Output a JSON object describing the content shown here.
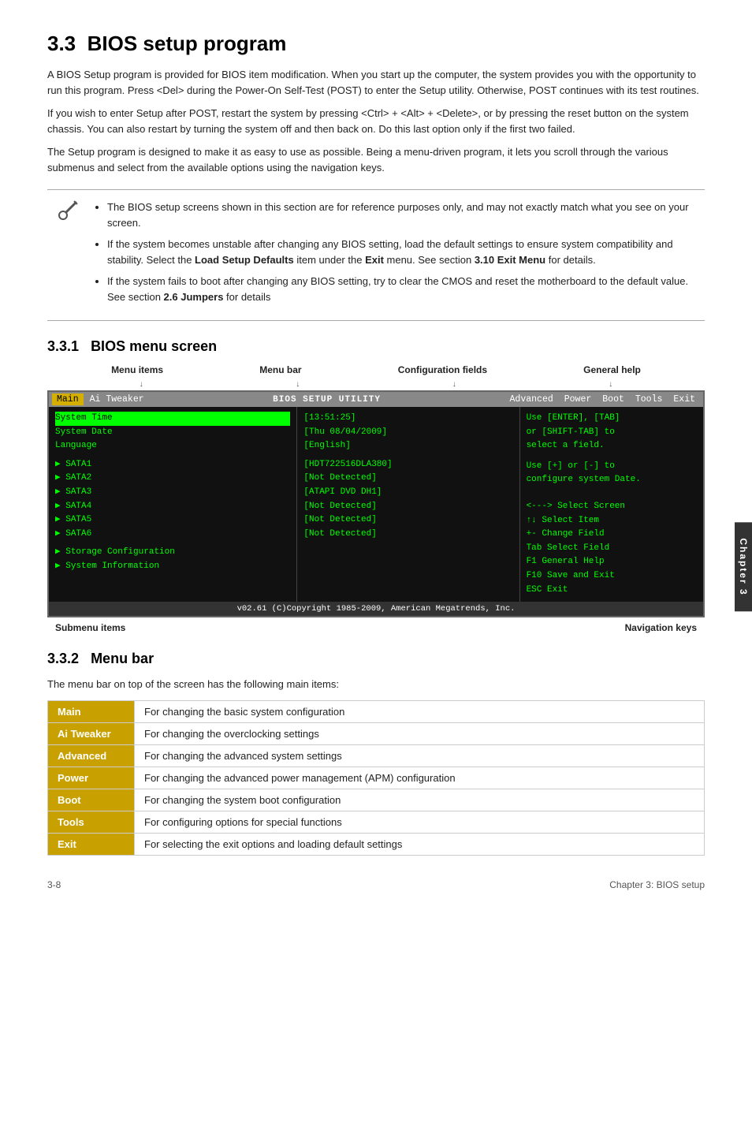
{
  "page": {
    "section": "3.3",
    "title": "BIOS setup program",
    "intro_paragraphs": [
      "A BIOS Setup program is provided for BIOS item modification. When you start up the computer, the system provides you with the opportunity to run this program. Press <Del> during the Power-On Self-Test (POST) to enter the Setup utility. Otherwise, POST continues with its test routines.",
      "If you wish to enter Setup after POST, restart the system by pressing <Ctrl> + <Alt> + <Delete>, or by pressing the reset button on the system chassis. You can also restart by turning the system off and then back on. Do this last option only if the first two failed.",
      "The Setup program is designed to make it as easy to use as possible. Being a menu-driven program, it lets you scroll through the various submenus and select from the available options using the navigation keys."
    ],
    "notes": [
      "The BIOS setup screens shown in this section are for reference purposes only, and may not exactly match what you see on your screen.",
      "If the system becomes unstable after changing any BIOS setting, load the default settings to ensure system compatibility and stability. Select the Load Setup Defaults item under the Exit menu. See section 3.10 Exit Menu for details.",
      "If the system fails to boot after changing any BIOS setting, try to clear the CMOS and reset the motherboard to the default value. See section 2.6 Jumpers for details"
    ],
    "subsection_331": {
      "number": "3.3.1",
      "title": "BIOS menu screen"
    },
    "bios_screen": {
      "title": "BIOS SETUP UTILITY",
      "menu_items": [
        "Main",
        "Ai Tweaker",
        "Advanced",
        "Power",
        "Boot",
        "Tools",
        "Exit"
      ],
      "active_menu": "Main",
      "left_panel": {
        "items": [
          "System Time",
          "System Date",
          "Language",
          "",
          "SATA1",
          "SATA2",
          "SATA3",
          "SATA4",
          "SATA5",
          "SATA6",
          "",
          "Storage Configuration",
          "System Information"
        ]
      },
      "middle_panel": {
        "items": [
          "[13:51:25]",
          "[Thu 08/04/2009]",
          "[English]",
          "",
          "[HDT722516DLA380]",
          "[Not Detected]",
          "[ATAPI DVD DH1]",
          "[Not Detected]",
          "[Not Detected]",
          "[Not Detected]"
        ]
      },
      "right_panel": {
        "help_text": [
          "Use [ENTER], [TAB]",
          "or [SHIFT-TAB] to",
          "select a field.",
          "",
          "Use [+] or [-] to",
          "configure system Date."
        ],
        "nav_text": [
          "<--->  Select Screen",
          "↑↓     Select Item",
          "+-     Change Field",
          "Tab    Select Field",
          "F1     General Help",
          "F10    Save and Exit",
          "ESC    Exit"
        ]
      },
      "footer": "v02.61 (C)Copyright 1985-2009, American Megatrends, Inc."
    },
    "diagram_labels": {
      "top": [
        "Menu items",
        "Menu bar",
        "Configuration fields",
        "General help"
      ],
      "bottom": [
        "Submenu items",
        "Navigation keys"
      ]
    },
    "subsection_332": {
      "number": "3.3.2",
      "title": "Menu bar",
      "intro": "The menu bar on top of the screen has the following main items:",
      "items": [
        {
          "label": "Main",
          "description": "For changing the basic system configuration"
        },
        {
          "label": "Ai Tweaker",
          "description": "For changing the overclocking settings"
        },
        {
          "label": "Advanced",
          "description": "For changing the advanced system settings"
        },
        {
          "label": "Power",
          "description": "For changing the advanced power management (APM) configuration"
        },
        {
          "label": "Boot",
          "description": "For changing the system boot configuration"
        },
        {
          "label": "Tools",
          "description": "For configuring options for special functions"
        },
        {
          "label": "Exit",
          "description": "For selecting the exit options and loading default settings"
        }
      ]
    },
    "page_footer": {
      "left": "3-8",
      "right": "Chapter 3: BIOS setup"
    },
    "sidebar": "Chapter 3"
  }
}
